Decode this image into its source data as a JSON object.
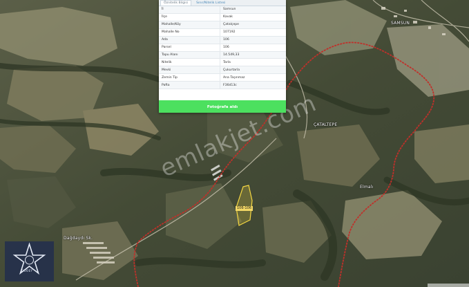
{
  "panel": {
    "tabs": [
      {
        "label": "Öznitelik Bilgisi",
        "active": true
      },
      {
        "label": "Sınır/Nitelik Listesi",
        "active": false
      }
    ],
    "rows": [
      {
        "key": "İl",
        "value": "Samsun"
      },
      {
        "key": "İlçe",
        "value": "Kavak"
      },
      {
        "key": "Mahalle/Köy",
        "value": "Çatalçepe"
      },
      {
        "key": "Mahalle No",
        "value": "107192"
      },
      {
        "key": "Ada",
        "value": "106"
      },
      {
        "key": "Parsel",
        "value": "106"
      },
      {
        "key": "Tapu Alanı",
        "value": "14.549,33"
      },
      {
        "key": "Nitelik",
        "value": "Tarla"
      },
      {
        "key": "Mevki",
        "value": "Çukurtarla"
      },
      {
        "key": "Zemin Tip",
        "value": "Ana Taşınmaz"
      },
      {
        "key": "Pafta",
        "value": "F36d13c"
      }
    ],
    "satellite_button": "Fotoğrafa aldı"
  },
  "map": {
    "labels": {
      "village_north": "SAMSUN",
      "village_catal": "ÇATALTEPE",
      "village_elmali": "Elmalı",
      "village_dagdaydi": "Dağdaydı Sk."
    },
    "parcel_label": "106-106"
  },
  "watermark": "emlakjet.com",
  "logo": {
    "text": "GOOEY"
  },
  "colors": {
    "boundary": "#c0302a",
    "parcel_outline": "#f5d742",
    "button_green": "#4ce05f",
    "tab_link": "#4a88b8"
  }
}
